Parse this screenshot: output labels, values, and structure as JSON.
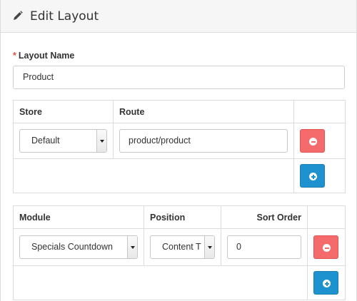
{
  "header": {
    "title": "Edit Layout",
    "icon": "pencil-icon"
  },
  "layout_name": {
    "required_mark": "*",
    "label": "Layout Name",
    "value": "Product"
  },
  "route_table": {
    "headers": {
      "store": "Store",
      "route": "Route"
    },
    "rows": [
      {
        "store": "Default",
        "route": "product/product"
      }
    ]
  },
  "module_table": {
    "headers": {
      "module": "Module",
      "position": "Position",
      "sort_order": "Sort Order"
    },
    "rows": [
      {
        "module": "Specials Countdown",
        "position": "Content T",
        "sort_order": "0"
      }
    ]
  },
  "colors": {
    "danger": "#f56b6b",
    "primary": "#1e91cf",
    "required": "#e3503e"
  }
}
